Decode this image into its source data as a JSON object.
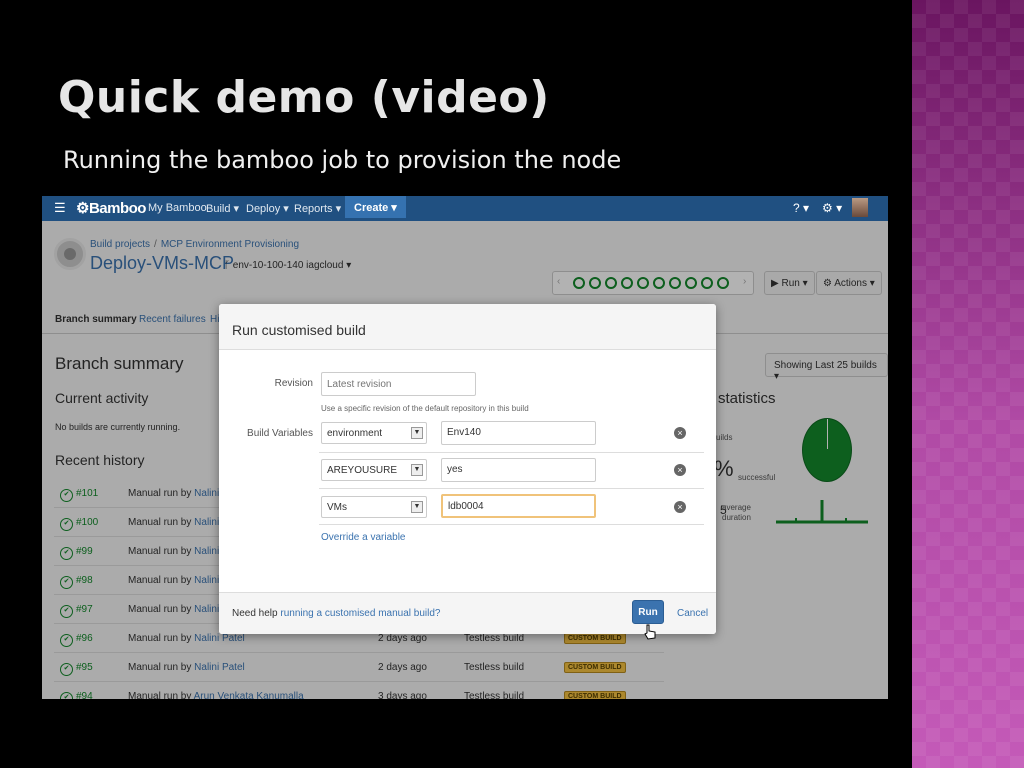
{
  "slide": {
    "title": "Quick demo (video)",
    "subtitle": "Running the bamboo job to provision the  node"
  },
  "topnav": {
    "logo": "Bamboo",
    "items": [
      "My Bamboo",
      "Build ▾",
      "Deploy ▾",
      "Reports ▾"
    ],
    "create": "Create ▾",
    "help": "? ▾",
    "settings": "⚙ ▾"
  },
  "header": {
    "breadcrumb": [
      "Build projects",
      "MCP Environment Provisioning"
    ],
    "plan_name": "Deploy-VMs-MCP",
    "branch": "env-10-100-140 iagcloud ▾",
    "run_button": "▶ Run ▾",
    "actions_button": "⚙ Actions ▾"
  },
  "tabs": [
    "Branch summary",
    "Recent failures",
    "Hi"
  ],
  "summary": {
    "title": "Branch summary",
    "current_activity": "Current activity",
    "no_builds": "No builds are currently running.",
    "recent_history": "Recent history",
    "showing": "Showing Last 25 builds ▾"
  },
  "statistics": {
    "title": "statistics",
    "builds_label": "uilds",
    "percent": "%",
    "successful": "successful",
    "average": "average",
    "duration": "duration",
    "small_num": "5"
  },
  "history": [
    {
      "num": "#101",
      "desc": "Manual run by",
      "who": "Nalini Pa",
      "when": "",
      "status": "",
      "badge": ""
    },
    {
      "num": "#100",
      "desc": "Manual run by",
      "who": "Nalini Pa",
      "when": "",
      "status": "",
      "badge": ""
    },
    {
      "num": "#99",
      "desc": "Manual run by",
      "who": "Nalini Pa",
      "when": "",
      "status": "",
      "badge": ""
    },
    {
      "num": "#98",
      "desc": "Manual run by",
      "who": "Nalini Pa",
      "when": "",
      "status": "",
      "badge": ""
    },
    {
      "num": "#97",
      "desc": "Manual run by",
      "who": "Nalini Pa",
      "when": "",
      "status": "",
      "badge": ""
    },
    {
      "num": "#96",
      "desc": "Manual run by",
      "who": "Nalini Patel",
      "when": "2 days ago",
      "status": "Testless build",
      "badge": "CUSTOM BUILD"
    },
    {
      "num": "#95",
      "desc": "Manual run by",
      "who": "Nalini Patel",
      "when": "2 days ago",
      "status": "Testless build",
      "badge": "CUSTOM BUILD"
    },
    {
      "num": "#94",
      "desc": "Manual run by",
      "who": "Arun Venkata Kanumalla",
      "when": "3 days ago",
      "status": "Testless build",
      "badge": "CUSTOM BUILD"
    }
  ],
  "modal": {
    "title": "Run customised build",
    "revision_label": "Revision",
    "revision_placeholder": "Latest revision",
    "revision_hint": "Use a specific revision of the default repository in this build",
    "variables_label": "Build Variables",
    "variables": [
      {
        "name": "environment",
        "value": "Env140"
      },
      {
        "name": "AREYOUSURE",
        "value": "yes"
      },
      {
        "name": "VMs",
        "value": "ldb0004"
      }
    ],
    "override_link": "Override a variable",
    "help_text": "Need help",
    "help_link": "running a customised manual build?",
    "run": "Run",
    "cancel": "Cancel"
  },
  "colors": {
    "nav_bg": "#205081",
    "success": "#14892c",
    "link": "#3b73af",
    "badge": "#f6c342",
    "slide_band": "#b04aa5"
  }
}
